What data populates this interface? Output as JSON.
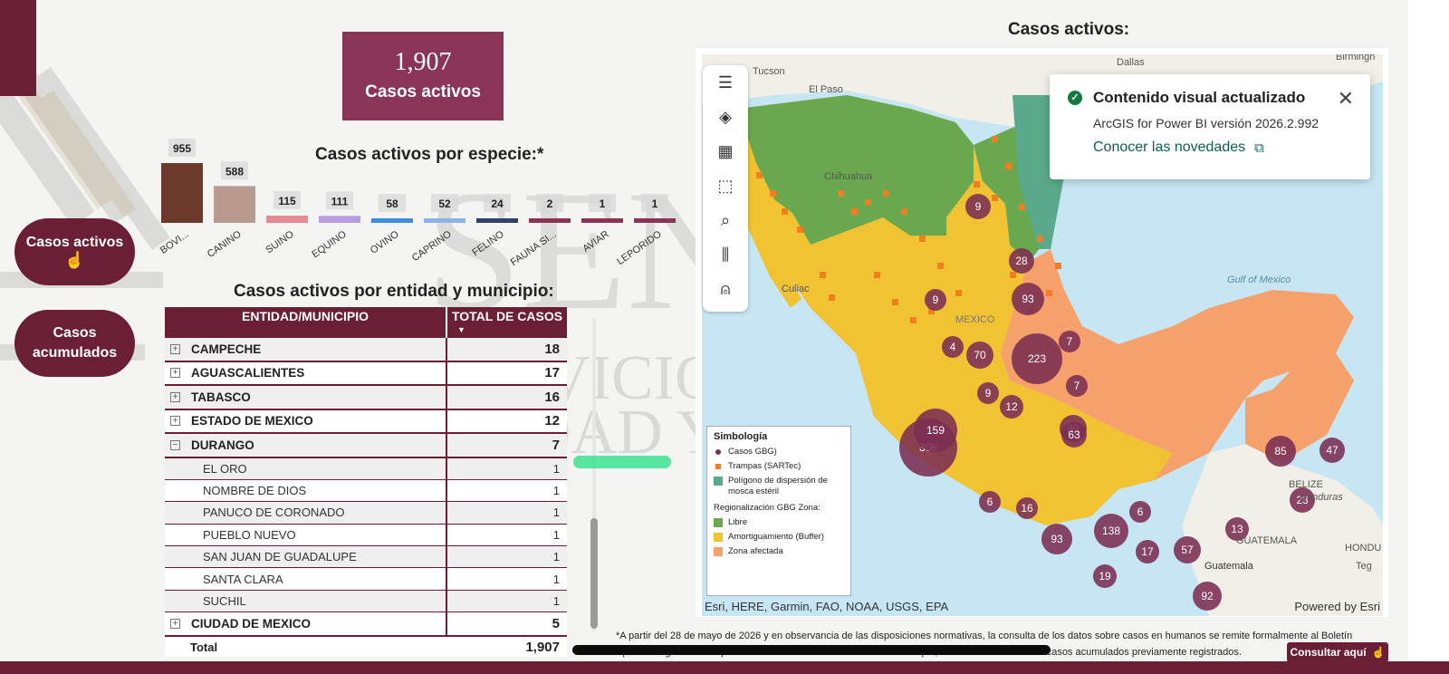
{
  "kpi": {
    "value": "1,907",
    "label": "Casos activos"
  },
  "titles": {
    "species": "Casos activos por especie:*",
    "entity": "Casos activos por entidad y municipio:",
    "map": "Casos activos:"
  },
  "nav": {
    "active_label": "Casos activos",
    "cumulative_label": "Casos acumulados"
  },
  "chart_data": {
    "type": "bar",
    "title": "Casos activos por especie:*",
    "categories": [
      "BOVI...",
      "CANINO",
      "SUINO",
      "EQUINO",
      "OVINO",
      "CAPRINO",
      "FELINO",
      "FAUNA SI...",
      "AVIAR",
      "LEPORIDO"
    ],
    "values": [
      955,
      588,
      115,
      111,
      58,
      52,
      24,
      2,
      1,
      1
    ],
    "colors": [
      "#6b3a2a",
      "#b89a8e",
      "#e98a93",
      "#b79be0",
      "#3f8de0",
      "#8cb3e6",
      "#2f3f6e",
      "#8a3458",
      "#8a3458",
      "#8a3458"
    ],
    "ylim": [
      0,
      955
    ],
    "grid": false
  },
  "table": {
    "headers": [
      "ENTIDAD/MUNICIPIO",
      "TOTAL DE CASOS"
    ],
    "rows": [
      {
        "name": "CAMPECHE",
        "value": "18"
      },
      {
        "name": "AGUASCALIENTES",
        "value": "17"
      },
      {
        "name": "TABASCO",
        "value": "16"
      },
      {
        "name": "ESTADO DE MEXICO",
        "value": "12"
      },
      {
        "name": "DURANGO",
        "value": "7"
      }
    ],
    "sub_rows": [
      {
        "name": "EL ORO",
        "value": "1"
      },
      {
        "name": "NOMBRE DE DIOS",
        "value": "1"
      },
      {
        "name": "PANUCO DE CORONADO",
        "value": "1"
      },
      {
        "name": "PUEBLO NUEVO",
        "value": "1"
      },
      {
        "name": "SAN JUAN DE GUADALUPE",
        "value": "1"
      },
      {
        "name": "SANTA CLARA",
        "value": "1"
      },
      {
        "name": "SUCHIL",
        "value": "1"
      }
    ],
    "last_row": {
      "name": "CIUDAD DE MEXICO",
      "value": "5"
    },
    "total": {
      "label": "Total",
      "value": "1,907"
    }
  },
  "map": {
    "place_labels": [
      "Tucson",
      "El Paso",
      "Dallas",
      "Chihuahua",
      "Culiac",
      "Gulf of Mexico",
      "BELIZE",
      "Honduras",
      "Guatemala",
      "GUATEMALA",
      "HONDU",
      "Teg",
      "MEXICO",
      "Birmingh"
    ],
    "bubbles": [
      "9",
      "28",
      "93",
      "9",
      "7",
      "4",
      "70",
      "223",
      "7",
      "9",
      "12",
      "80",
      "306",
      "63",
      "159",
      "6",
      "16",
      "6",
      "138",
      "93",
      "17",
      "57",
      "19",
      "13",
      "85",
      "47",
      "23",
      "92"
    ],
    "legend": {
      "title": "Simbología",
      "items": [
        "Casos GBG)",
        "Trampas (SARTec)",
        "Polígono de dispersión de mosca estéril"
      ],
      "subtitle": "Regionalización GBG Zona:",
      "zones": [
        "Libre",
        "Amortiguamiento (Buffer)",
        "Zona afectada"
      ]
    },
    "attribution": "Esri, HERE, Garmin, FAO, NOAA, USGS, EPA",
    "powered": "Powered by Esri",
    "toolbar_icons": [
      "menu-icon",
      "layers-icon",
      "qr-icon",
      "select-icon",
      "search-icon",
      "chart-icon",
      "user-icon"
    ],
    "colors": {
      "libre": "#6aa84f",
      "buffer": "#f1c232",
      "afectada": "#f6a06b",
      "case": "#7b2e52",
      "trap": "#f57c1f",
      "sterile": "#5aa98a",
      "water": "#c5e6f2"
    }
  },
  "toast": {
    "title": "Contenido visual actualizado",
    "version": "ArcGIS for Power BI versión 2026.2.992",
    "link": "Conocer las novedades"
  },
  "footnote": "*A partir del 28 de mayo de 2026 y en observancia de las disposiciones normativas, la consulta de los datos sobre casos en humanos se remite formalmente al Boletín Epidemiológico emitido por la Secretaría de Salud. Cabe mencionar que, el sistema conserva los casos acumulados previamente registrados.",
  "consult_button": "Consultar aquí"
}
